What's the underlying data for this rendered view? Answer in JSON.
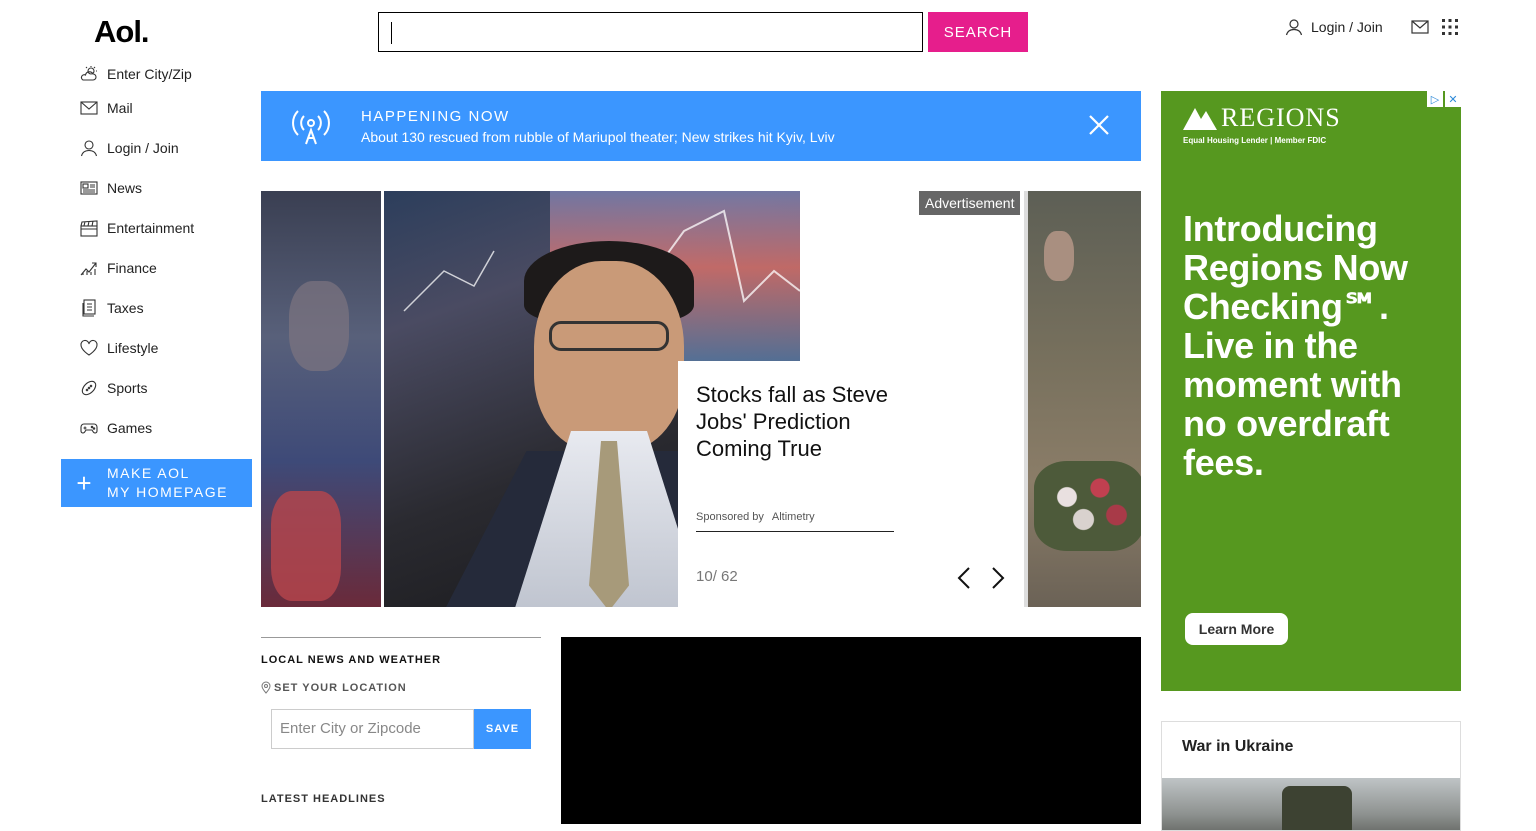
{
  "header": {
    "logo": "Aol.",
    "search_value": "",
    "search_button": "SEARCH",
    "login_label": "Login / Join"
  },
  "sidenav": {
    "items": [
      {
        "label": "Enter City/Zip",
        "icon": "weather-icon"
      },
      {
        "label": "Mail",
        "icon": "mail-icon"
      },
      {
        "label": "Login / Join",
        "icon": "user-icon"
      },
      {
        "label": "News",
        "icon": "news-icon"
      },
      {
        "label": "Entertainment",
        "icon": "clapper-icon"
      },
      {
        "label": "Finance",
        "icon": "chart-icon"
      },
      {
        "label": "Taxes",
        "icon": "document-icon"
      },
      {
        "label": "Lifestyle",
        "icon": "heart-icon"
      },
      {
        "label": "Sports",
        "icon": "football-icon"
      },
      {
        "label": "Games",
        "icon": "gamepad-icon"
      }
    ],
    "homepage_line1": "MAKE AOL",
    "homepage_line2": "MY HOMEPAGE"
  },
  "banner": {
    "title": "HAPPENING NOW",
    "text": "About 130 rescued from rubble of Mariupol theater; New strikes hit Kyiv, Lviv"
  },
  "carousel": {
    "headline": "Stocks fall as Steve Jobs' Prediction Coming True",
    "sponsored_by": "Sponsored by",
    "sponsor": "Altimetry",
    "index": "10",
    "total": "/ 62",
    "ad_label": "Advertisement"
  },
  "local": {
    "heading": "LOCAL NEWS AND WEATHER",
    "set_location": "SET YOUR LOCATION",
    "zip_placeholder": "Enter City or Zipcode",
    "save": "SAVE",
    "latest": "LATEST HEADLINES"
  },
  "ad": {
    "brand": "REGIONS",
    "fdic": "Equal Housing Lender | Member FDIC",
    "copy": "Introducing Regions Now Checking℠. Live in the moment with no overdraft fees.",
    "cta": "Learn More",
    "color": "#56981f"
  },
  "module": {
    "title": "War in Ukraine"
  },
  "colors": {
    "accent_blue": "#3b96ff",
    "search_pink": "#e61e8c"
  }
}
